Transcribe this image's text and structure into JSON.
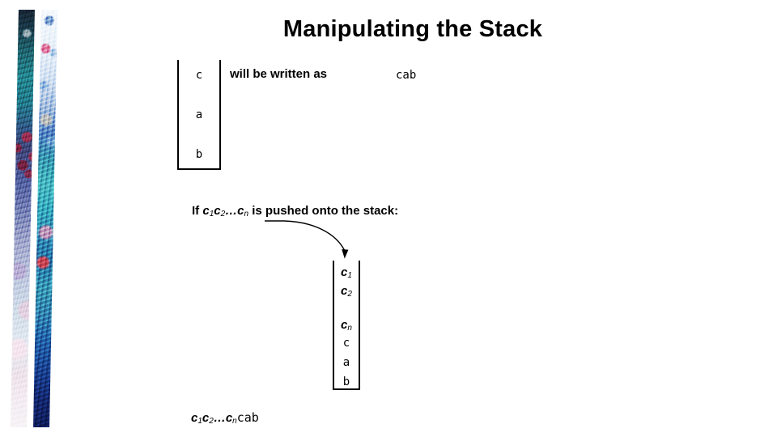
{
  "slide": {
    "title": "Manipulating the Stack",
    "background_color": "#ffffff",
    "text_color": "#000000"
  },
  "decor": {
    "left_border_name": "decorative-mosaic-border",
    "strip_count": 2,
    "palette": [
      "#171b2a",
      "#217a83",
      "#6a74ad",
      "#f7f4f7",
      "#f6f9fc",
      "#3ba0a4",
      "#0c1640"
    ]
  },
  "stack_one": {
    "name": "stack-before",
    "cells": [
      {
        "text": "c",
        "style": "mono"
      },
      {
        "text": "a",
        "style": "mono"
      },
      {
        "text": "b",
        "style": "mono"
      }
    ]
  },
  "stack_two": {
    "name": "stack-after-push",
    "cells": [
      {
        "base": "c",
        "sub": "1",
        "style": "sym"
      },
      {
        "base": "c",
        "sub": "2",
        "style": "sym"
      },
      {
        "base": "c",
        "sub": "n",
        "style": "sym"
      },
      {
        "text": "c",
        "style": "mono"
      },
      {
        "text": "a",
        "style": "mono"
      },
      {
        "text": "b",
        "style": "mono"
      }
    ]
  },
  "labels": {
    "written_as": "will be written as",
    "cab_result": "cab",
    "push_sentence_prefix": "If ",
    "push_sentence_suffix": " is pushed onto the stack:",
    "ellipsis": "…",
    "c_base": "c",
    "sub_1": "1",
    "sub_2": "2",
    "sub_n": "n",
    "result_tail": "cab"
  }
}
